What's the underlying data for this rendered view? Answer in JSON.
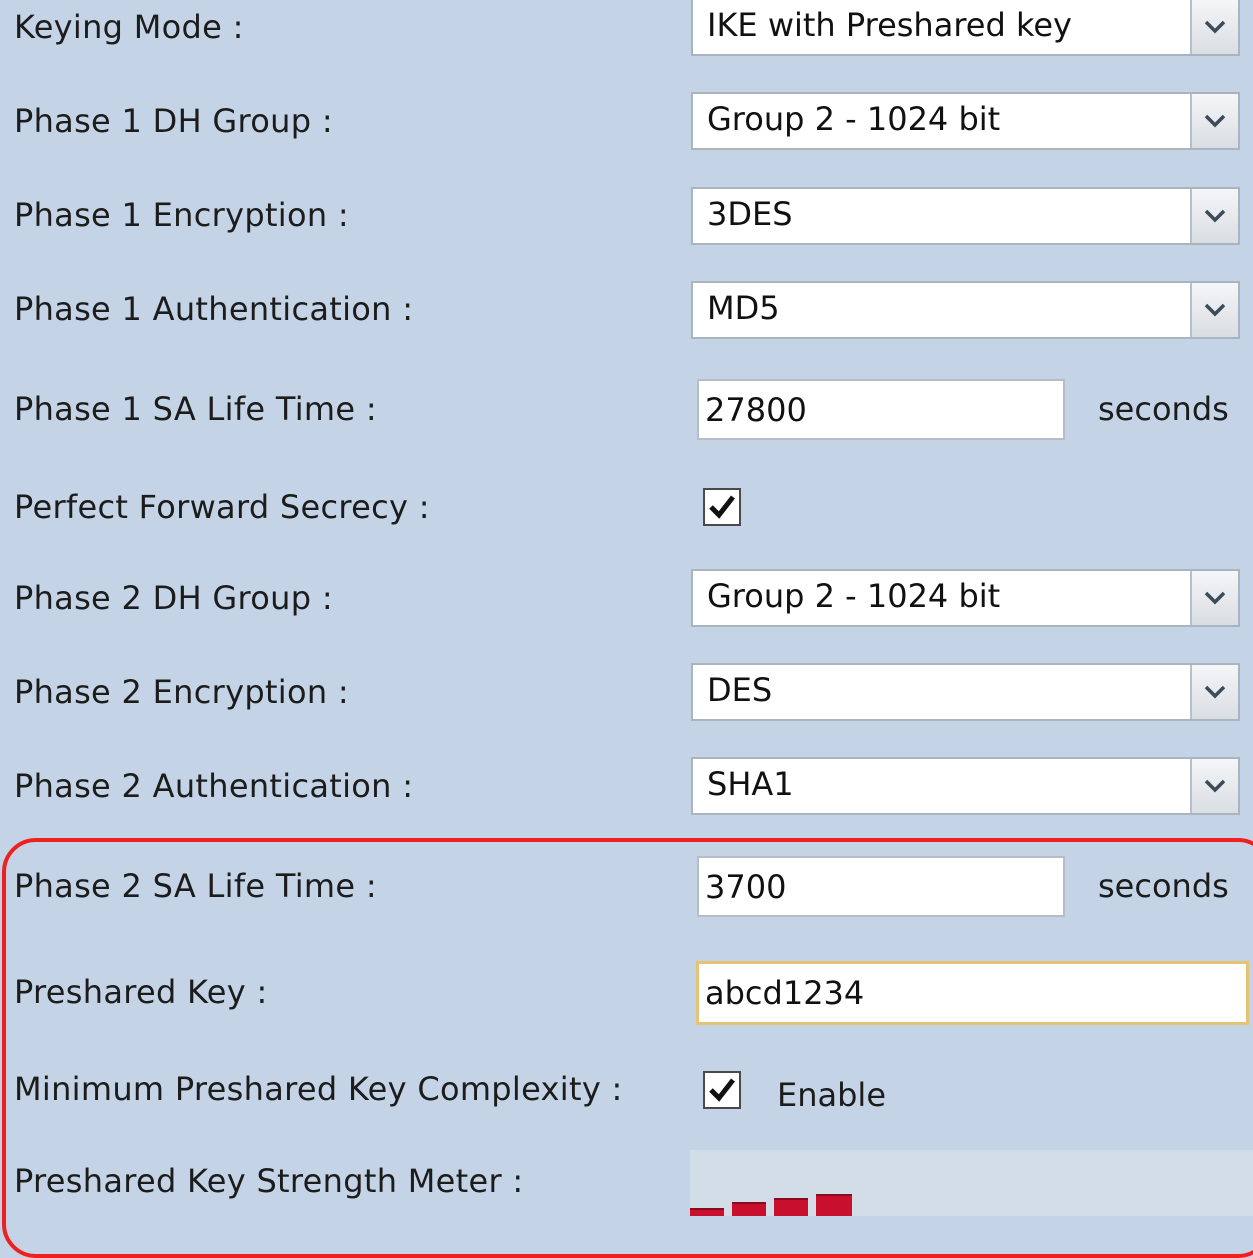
{
  "form": {
    "keying_mode": {
      "label": "Keying Mode :",
      "value": "IKE with Preshared key"
    },
    "phase1_dh_group": {
      "label": "Phase 1 DH Group :",
      "value": "Group 2 - 1024 bit"
    },
    "phase1_encryption": {
      "label": "Phase 1 Encryption :",
      "value": "3DES"
    },
    "phase1_authentication": {
      "label": "Phase 1 Authentication :",
      "value": "MD5"
    },
    "phase1_sa_life_time": {
      "label": "Phase 1 SA Life Time :",
      "value": "27800",
      "unit": "seconds"
    },
    "perfect_forward_secrecy": {
      "label": "Perfect Forward Secrecy :",
      "checked": true
    },
    "phase2_dh_group": {
      "label": "Phase 2 DH Group :",
      "value": "Group 2 - 1024 bit"
    },
    "phase2_encryption": {
      "label": "Phase 2 Encryption :",
      "value": "DES"
    },
    "phase2_authentication": {
      "label": "Phase 2 Authentication :",
      "value": "SHA1"
    },
    "phase2_sa_life_time": {
      "label": "Phase 2 SA Life Time :",
      "value": "3700",
      "unit": "seconds"
    },
    "preshared_key": {
      "label": "Preshared Key :",
      "value": "abcd1234"
    },
    "min_key_complexity": {
      "label": "Minimum Preshared Key Complexity :",
      "checked": true,
      "option_label": "Enable"
    },
    "key_strength_meter": {
      "label": "Preshared Key Strength Meter :",
      "filled_segments": 4
    }
  },
  "colors": {
    "background": "#c4d4e6",
    "highlight_border": "#ee2020",
    "meter_fill": "#c8102e"
  },
  "icons": {
    "dropdown": "chevron-down-icon",
    "checkbox": "checkmark-icon"
  }
}
